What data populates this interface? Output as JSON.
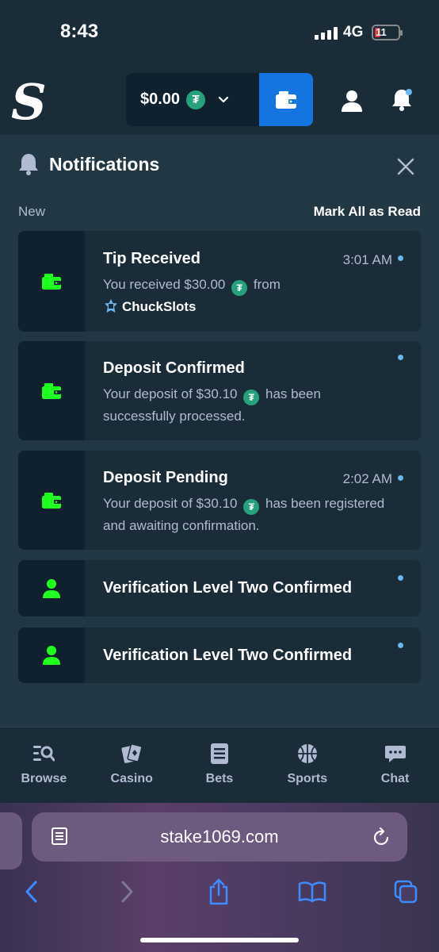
{
  "status_bar": {
    "time": "8:43",
    "network": "4G",
    "battery": "11"
  },
  "header": {
    "logo": "S",
    "balance": "$0.00",
    "currency_icon": "tether-icon",
    "currency_symbol": "₮"
  },
  "panel": {
    "title": "Notifications",
    "section_label": "New",
    "mark_all_label": "Mark All as Read",
    "notifications": [
      {
        "icon": "wallet-icon",
        "title": "Tip Received",
        "time": "3:01 AM",
        "body_prefix": "You received $30.00",
        "body_suffix": "from",
        "user": "ChuckSlots",
        "unread": true
      },
      {
        "icon": "wallet-icon",
        "title": "Deposit Confirmed",
        "time": "",
        "body_prefix": "Your deposit of $30.10",
        "body_suffix": "has been successfully processed.",
        "unread": true
      },
      {
        "icon": "wallet-icon",
        "title": "Deposit Pending",
        "time": "2:02 AM",
        "body_prefix": "Your deposit of $30.10",
        "body_suffix": "has been registered and awaiting confirmation.",
        "unread": true
      },
      {
        "icon": "user-icon",
        "title": "Verification Level Two Confirmed",
        "unread": true
      },
      {
        "icon": "user-icon",
        "title": "Verification Level Two Confirmed",
        "unread": true
      }
    ]
  },
  "bottom_nav": [
    {
      "label": "Browse",
      "icon": "browse-icon"
    },
    {
      "label": "Casino",
      "icon": "casino-cards-icon"
    },
    {
      "label": "Bets",
      "icon": "bets-list-icon"
    },
    {
      "label": "Sports",
      "icon": "basketball-icon"
    },
    {
      "label": "Chat",
      "icon": "chat-icon"
    }
  ],
  "browser": {
    "url": "stake1069.com"
  },
  "colors": {
    "accent_green": "#1fff20",
    "brand_blue": "#1475e1",
    "unread_dot": "#6ab6ef",
    "tether_green": "#26a17b"
  }
}
